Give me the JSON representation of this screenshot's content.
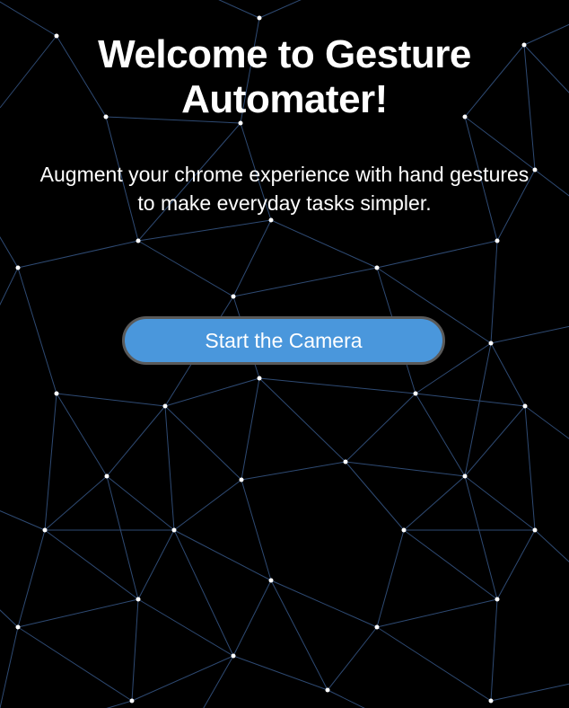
{
  "page": {
    "title": "Welcome to Gesture Automater!",
    "subtitle": "Augment your chrome experience with hand gestures to make everyday tasks simpler.",
    "start_button_label": "Start the Camera"
  },
  "colors": {
    "background": "#000000",
    "network_line": "#2e4a73",
    "network_node": "#ffffff",
    "button_fill": "#4a97dc",
    "button_border": "#5a5a5a",
    "text": "#ffffff"
  }
}
